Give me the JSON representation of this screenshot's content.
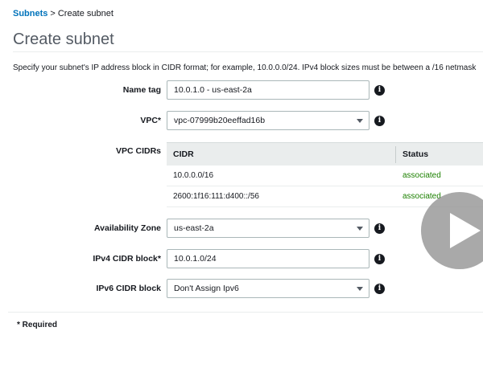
{
  "breadcrumb": {
    "parent": "Subnets",
    "separator": ">",
    "current": "Create subnet"
  },
  "page": {
    "title": "Create subnet",
    "description": "Specify your subnet's IP address block in CIDR format; for example, 10.0.0.0/24. IPv4 block sizes must be between a /16 netmask"
  },
  "form": {
    "name_tag": {
      "label": "Name tag",
      "value": "10.0.1.0 - us-east-2a"
    },
    "vpc": {
      "label": "VPC*",
      "value": "vpc-07999b20eeffad16b"
    },
    "vpc_cidrs": {
      "label": "VPC CIDRs",
      "columns": [
        "CIDR",
        "Status"
      ],
      "rows": [
        {
          "cidr": "10.0.0.0/16",
          "status": "associated"
        },
        {
          "cidr": "2600:1f16:111:d400::/56",
          "status": "associated"
        }
      ]
    },
    "availability_zone": {
      "label": "Availability Zone",
      "value": "us-east-2a"
    },
    "ipv4_cidr": {
      "label": "IPv4 CIDR block*",
      "value": "10.0.1.0/24"
    },
    "ipv6_cidr": {
      "label": "IPv6 CIDR block",
      "value": "Don't Assign Ipv6"
    }
  },
  "info_glyph": "i",
  "footer": {
    "required_note": "* Required"
  },
  "colors": {
    "link": "#0073bb",
    "status_ok": "#1d8102",
    "header_bg": "#eaeded"
  },
  "icons": {
    "info": "info-icon",
    "dropdown": "chevron-down-icon",
    "play": "play-icon"
  }
}
